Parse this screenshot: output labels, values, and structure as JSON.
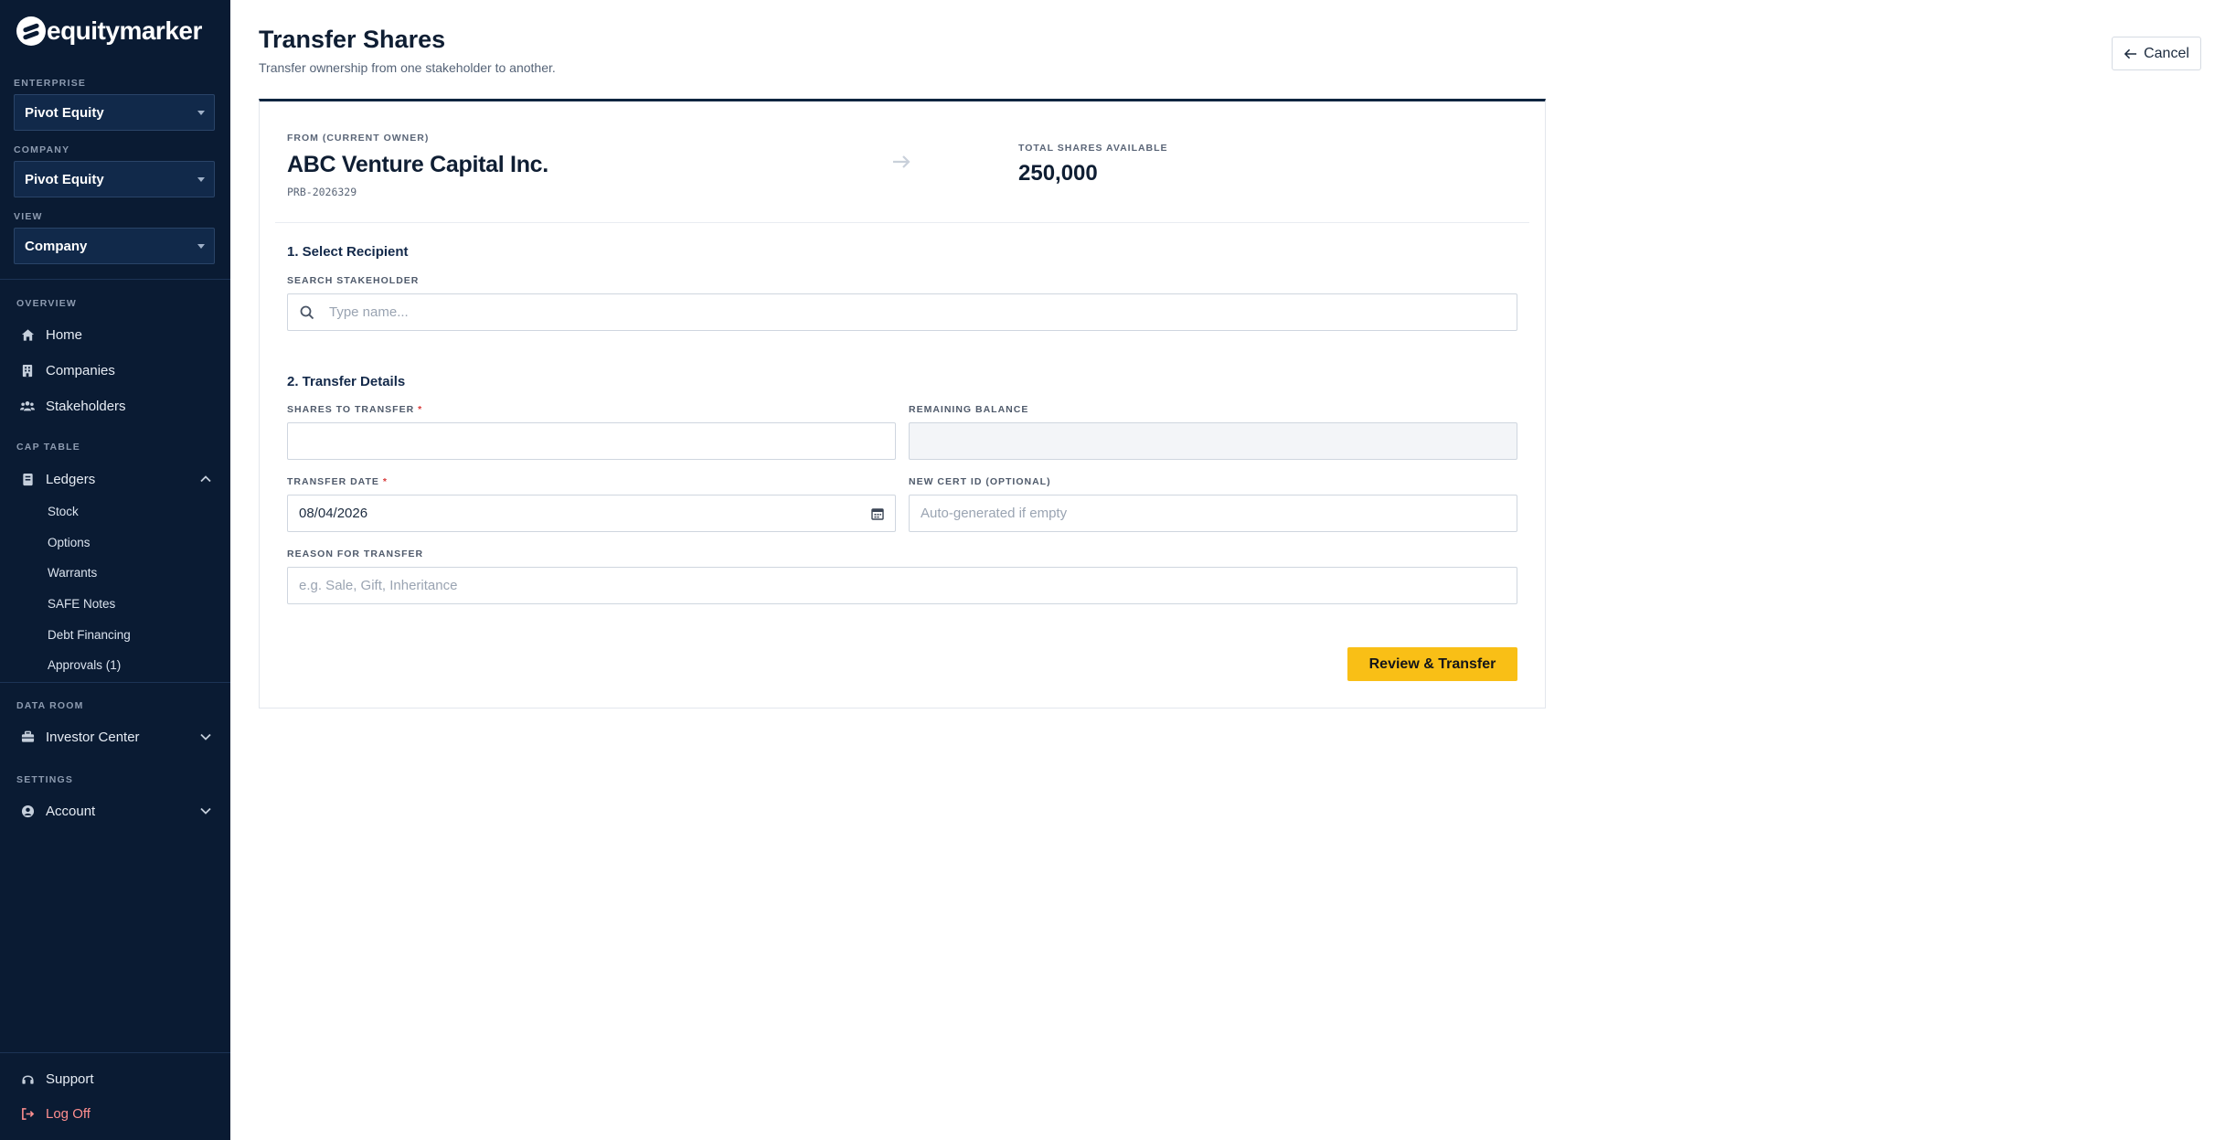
{
  "brand": {
    "logo_text": "equitymarker"
  },
  "sidebar": {
    "enterprise": {
      "label": "ENTERPRISE",
      "value": "Pivot Equity"
    },
    "company": {
      "label": "COMPANY",
      "value": "Pivot Equity"
    },
    "view": {
      "label": "VIEW",
      "value": "Company"
    },
    "overview": {
      "label": "OVERVIEW",
      "items": [
        {
          "label": "Home",
          "icon": "home-icon"
        },
        {
          "label": "Companies",
          "icon": "building-icon"
        },
        {
          "label": "Stakeholders",
          "icon": "users-icon"
        }
      ]
    },
    "cap_table": {
      "label": "CAP TABLE",
      "ledgers": {
        "label": "Ledgers",
        "icon": "ledger-icon",
        "expanded": true
      },
      "sub_items": [
        "Stock",
        "Options",
        "Warrants",
        "SAFE Notes",
        "Debt Financing",
        "Approvals (1)"
      ]
    },
    "data_room": {
      "label": "DATA ROOM",
      "investor_center": {
        "label": "Investor Center",
        "icon": "briefcase-icon"
      }
    },
    "settings": {
      "label": "SETTINGS",
      "account": {
        "label": "Account",
        "icon": "user-circle-icon"
      }
    },
    "support": {
      "label": "Support",
      "icon": "headset-icon"
    },
    "logoff": {
      "label": "Log Off",
      "icon": "logout-icon",
      "color": "#ff8f8f"
    }
  },
  "header": {
    "title": "Transfer Shares",
    "subtitle": "Transfer ownership from one stakeholder to another.",
    "cancel_label": "Cancel"
  },
  "transfer": {
    "from_label": "FROM (CURRENT OWNER)",
    "from_name": "ABC Venture Capital Inc.",
    "from_id": "PRB-2026329",
    "total_label": "TOTAL SHARES AVAILABLE",
    "total_value": "250,000",
    "section1_title": "1. Select Recipient",
    "search_label": "SEARCH STAKEHOLDER",
    "search_placeholder": "Type name...",
    "section2_title": "2. Transfer Details",
    "shares_label": "SHARES TO TRANSFER",
    "shares_value": "",
    "remaining_label": "REMAINING BALANCE",
    "remaining_value": "",
    "date_label": "TRANSFER DATE",
    "date_value": "08/04/2026",
    "cert_label": "NEW CERT ID (OPTIONAL)",
    "cert_placeholder": "Auto-generated if empty",
    "reason_label": "REASON FOR TRANSFER",
    "reason_placeholder": "e.g. Sale, Gift, Inheritance",
    "required_mark": "*",
    "submit_label": "Review & Transfer"
  },
  "colors": {
    "sidebar_bg": "#0a1b33",
    "accent_button": "#f9bf16",
    "card_top_border": "#0f2540",
    "required": "#d83a3a"
  }
}
